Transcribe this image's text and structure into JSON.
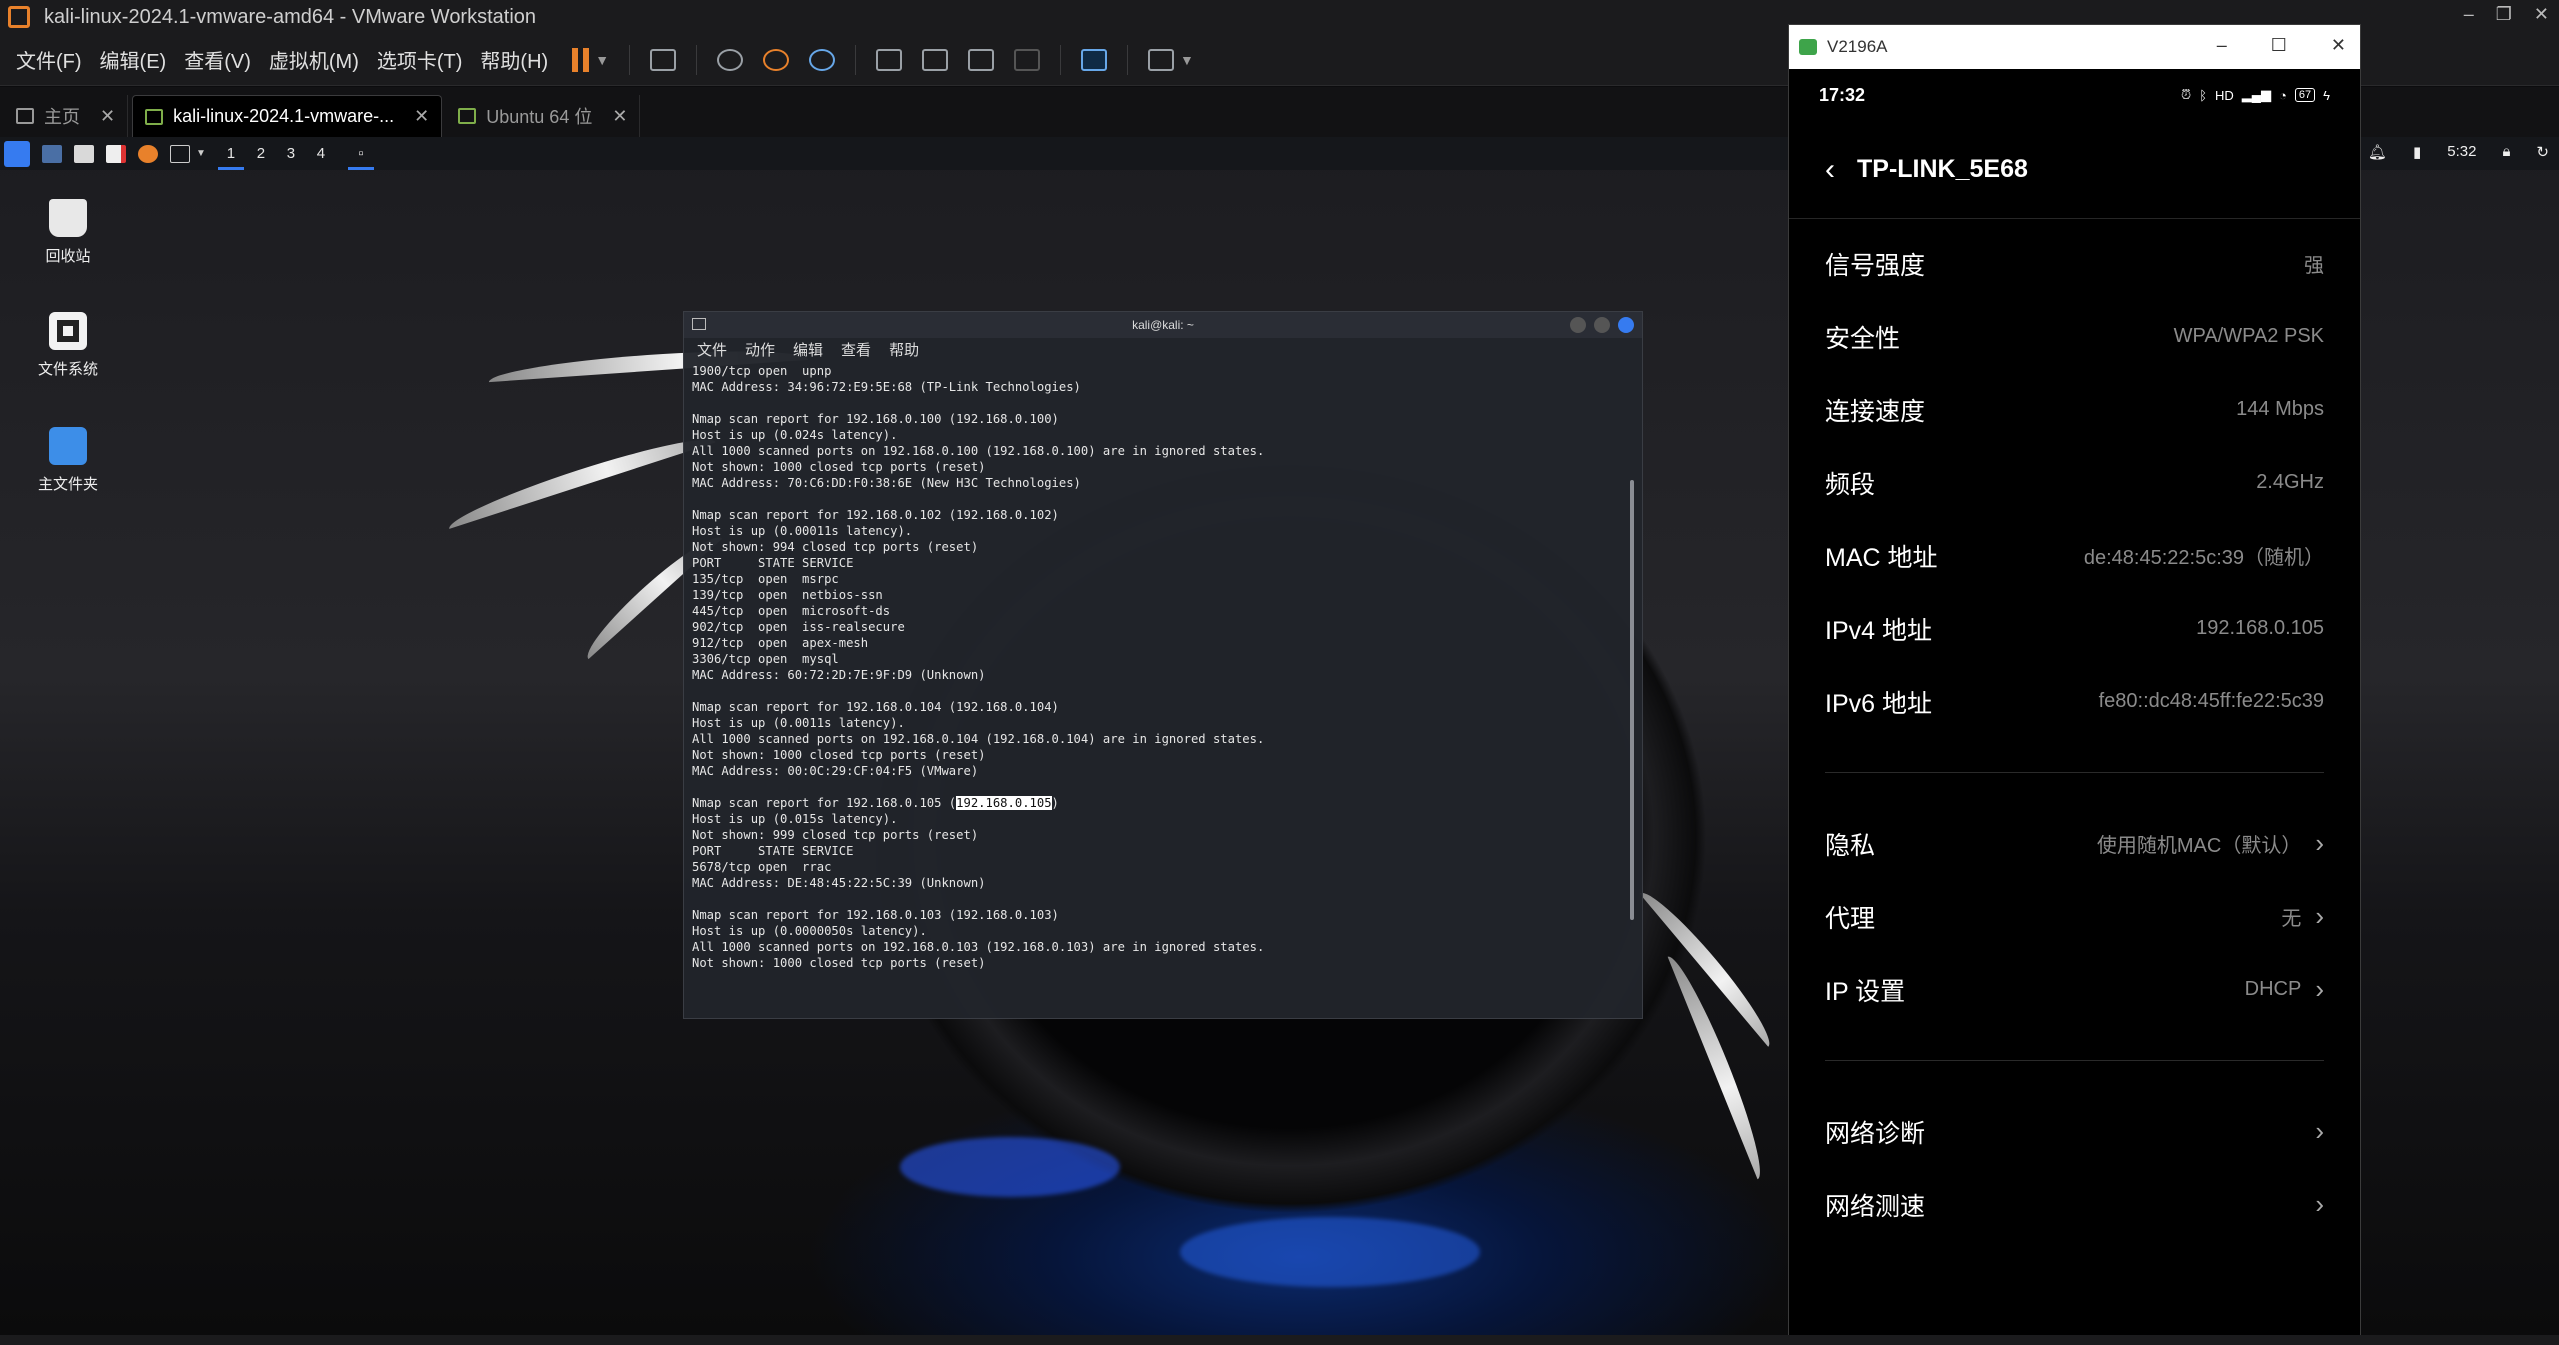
{
  "vmware": {
    "title": "kali-linux-2024.1-vmware-amd64 - VMware Workstation",
    "menu": [
      "文件(F)",
      "编辑(E)",
      "查看(V)",
      "虚拟机(M)",
      "选项卡(T)",
      "帮助(H)"
    ],
    "tabs": [
      {
        "label": "主页",
        "icon": "home-icon"
      },
      {
        "label": "kali-linux-2024.1-vmware-...",
        "icon": "vm-icon",
        "active": true
      },
      {
        "label": "Ubuntu 64 位",
        "icon": "vm-icon"
      }
    ],
    "accent": "#e8812b"
  },
  "kali": {
    "workspaces": [
      "1",
      "2",
      "3",
      "4"
    ],
    "clock": "5:32",
    "desktop_icons": [
      {
        "label": "回收站",
        "icon": "trash-icon"
      },
      {
        "label": "文件系统",
        "icon": "filesystem-icon"
      },
      {
        "label": "主文件夹",
        "icon": "home-folder-icon"
      }
    ],
    "terminal": {
      "title": "kali@kali: ~",
      "menu": [
        "文件",
        "动作",
        "编辑",
        "查看",
        "帮助"
      ],
      "lines_before": "1900/tcp open  upnp\nMAC Address: 34:96:72:E9:5E:68 (TP-Link Technologies)\n\nNmap scan report for 192.168.0.100 (192.168.0.100)\nHost is up (0.024s latency).\nAll 1000 scanned ports on 192.168.0.100 (192.168.0.100) are in ignored states.\nNot shown: 1000 closed tcp ports (reset)\nMAC Address: 70:C6:DD:F0:38:6E (New H3C Technologies)\n\nNmap scan report for 192.168.0.102 (192.168.0.102)\nHost is up (0.00011s latency).\nNot shown: 994 closed tcp ports (reset)\nPORT     STATE SERVICE\n135/tcp  open  msrpc\n139/tcp  open  netbios-ssn\n445/tcp  open  microsoft-ds\n902/tcp  open  iss-realsecure\n912/tcp  open  apex-mesh\n3306/tcp open  mysql\nMAC Address: 60:72:2D:7E:9F:D9 (Unknown)\n\nNmap scan report for 192.168.0.104 (192.168.0.104)\nHost is up (0.0011s latency).\nAll 1000 scanned ports on 192.168.0.104 (192.168.0.104) are in ignored states.\nNot shown: 1000 closed tcp ports (reset)\nMAC Address: 00:0C:29:CF:04:F5 (VMware)\n\n",
      "sel_prefix": "Nmap scan report for 192.168.0.105 (",
      "sel_text": "192.168.0.105",
      "sel_suffix": ")",
      "lines_after": "\nHost is up (0.015s latency).\nNot shown: 999 closed tcp ports (reset)\nPORT     STATE SERVICE\n5678/tcp open  rrac\nMAC Address: DE:48:45:22:5C:39 (Unknown)\n\nNmap scan report for 192.168.0.103 (192.168.0.103)\nHost is up (0.0000050s latency).\nAll 1000 scanned ports on 192.168.0.103 (192.168.0.103) are in ignored states.\nNot shown: 1000 closed tcp ports (reset)"
    }
  },
  "phone": {
    "window_title": "V2196A",
    "time": "17:32",
    "battery": "67",
    "network_name": "TP-LINK_5E68",
    "details": [
      {
        "label": "信号强度",
        "value": "强"
      },
      {
        "label": "安全性",
        "value": "WPA/WPA2 PSK"
      },
      {
        "label": "连接速度",
        "value": "144 Mbps"
      },
      {
        "label": "频段",
        "value": "2.4GHz"
      },
      {
        "label": "MAC 地址",
        "value": "de:48:45:22:5c:39（随机）"
      },
      {
        "label": "IPv4 地址",
        "value": "192.168.0.105"
      },
      {
        "label": "IPv6 地址",
        "value": "fe80::dc48:45ff:fe22:5c39"
      }
    ],
    "settings": [
      {
        "label": "隐私",
        "value": "使用随机MAC（默认）"
      },
      {
        "label": "代理",
        "value": "无"
      },
      {
        "label": "IP 设置",
        "value": "DHCP"
      }
    ],
    "tools": [
      {
        "label": "网络诊断"
      },
      {
        "label": "网络测速"
      }
    ]
  }
}
